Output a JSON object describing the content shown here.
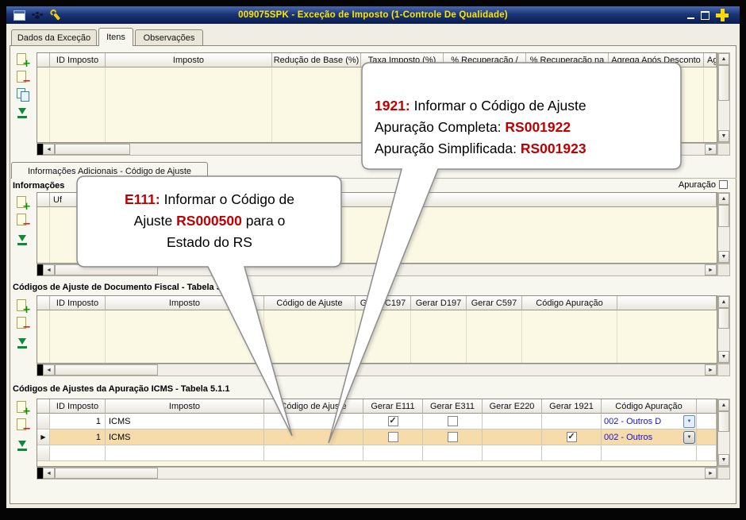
{
  "window": {
    "title": "009075SPK - Exceção de Imposto (1-Controle De Qualidade)"
  },
  "main_tabs": {
    "dados": "Dados da Exceção",
    "itens": "Itens",
    "observacoes": "Observações"
  },
  "items_grid": {
    "columns": [
      "ID Imposto",
      "Imposto",
      "Redução de Base (%)",
      "Taxa Imposto (%)",
      "% Recuperação /",
      "% Recuperação na",
      "Agrega Após Desconto",
      "Ag"
    ]
  },
  "info_section": {
    "tab_label": "Informações Adicionais - Código de Ajuste",
    "title": "Informações",
    "apuracao_label": "Apuração",
    "columns": [
      "Uf"
    ]
  },
  "doc_section": {
    "title": "Códigos de Ajuste de Documento Fiscal - Tabela 5.1.1",
    "columns": [
      "ID Imposto",
      "Imposto",
      "Código de Ajuste",
      "Gerar C197",
      "Gerar D197",
      "Gerar C597",
      "Código Apuração"
    ]
  },
  "apur_section": {
    "title": "Códigos de Ajustes da Apuração ICMS - Tabela 5.1.1",
    "columns": [
      "ID Imposto",
      "Imposto",
      "Código de Ajuste",
      "Gerar E111",
      "Gerar E311",
      "Gerar E220",
      "Gerar 1921",
      "Código Apuração"
    ],
    "rows": [
      {
        "id_imposto": "1",
        "imposto": "ICMS",
        "codigo_ajuste": "",
        "gerar_e111": "checked",
        "gerar_e311": "unchecked",
        "gerar_e220": "none",
        "gerar_1921": "none",
        "codigo_apuracao": "002 - Outros D"
      },
      {
        "id_imposto": "1",
        "imposto": "ICMS",
        "codigo_ajuste": "",
        "gerar_e111": "unchecked",
        "gerar_e311": "unchecked",
        "gerar_e220": "none",
        "gerar_1921": "checked",
        "codigo_apuracao": "002 - Outros"
      }
    ]
  },
  "callout_1921": {
    "prefix": "1921:",
    "line1": " Informar o Código de Ajuste",
    "line2_pre": "Apuração Completa: ",
    "code_complete": "RS001922",
    "line3_pre": "Apuração Simplificada: ",
    "code_simple": "RS001923"
  },
  "callout_e111": {
    "prefix": "E111:",
    "line1": " Informar o Código de",
    "line2_pre": "Ajuste ",
    "code": "RS000500",
    "line2_post": " para o",
    "line3": "Estado do RS"
  },
  "icons": {
    "scroll_left": "◄",
    "scroll_right": "►",
    "scroll_up": "▲",
    "scroll_down": "▼",
    "row_marker": "▶",
    "combo_caret": "▼",
    "checkbox_check": "✓"
  },
  "colors": {
    "titlebar_text": "#ffe600",
    "titlebar_bg": "#1a3577",
    "callout_red": "#c00000",
    "selected_row_bg": "#f6dcab",
    "combo_text": "#1414cc",
    "grid_body_bg": "#fbf8e3"
  }
}
